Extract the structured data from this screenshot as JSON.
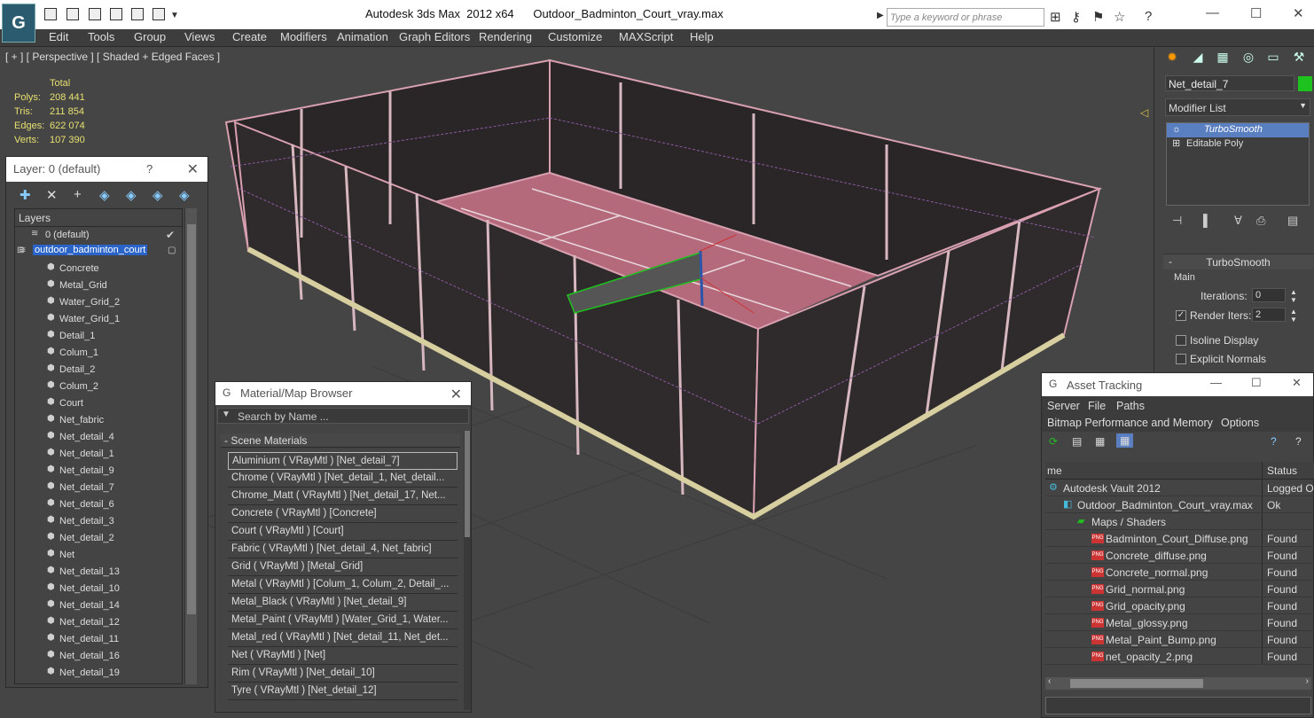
{
  "window": {
    "app_title": "Autodesk 3ds Max  2012 x64",
    "file_title": "Outdoor_Badminton_Court_vray.max"
  },
  "search": {
    "placeholder": "Type a keyword or phrase"
  },
  "menu": [
    "Edit",
    "Tools",
    "Group",
    "Views",
    "Create",
    "Modifiers",
    "Animation",
    "Graph Editors",
    "Rendering",
    "Customize",
    "MAXScript",
    "Help"
  ],
  "viewport": {
    "label": "[ + ] [ Perspective ] [ Shaded + Edged Faces ]",
    "stats": {
      "header": "Total",
      "polys_label": "Polys:",
      "polys": "208 441",
      "tris_label": "Tris:",
      "tris": "211 854",
      "edges_label": "Edges:",
      "edges": "622 074",
      "verts_label": "Verts:",
      "verts": "107 390"
    }
  },
  "layer_panel": {
    "title": "Layer: 0 (default)",
    "help": "?",
    "list_header": "Layers",
    "rows": [
      "0 (default)",
      "outdoor_badminton_court",
      "Concrete",
      "Metal_Grid",
      "Water_Grid_2",
      "Water_Grid_1",
      "Detail_1",
      "Colum_1",
      "Detail_2",
      "Colum_2",
      "Court",
      "Net_fabric",
      "Net_detail_4",
      "Net_detail_1",
      "Net_detail_9",
      "Net_detail_7",
      "Net_detail_6",
      "Net_detail_3",
      "Net_detail_2",
      "Net",
      "Net_detail_13",
      "Net_detail_10",
      "Net_detail_14",
      "Net_detail_12",
      "Net_detail_11",
      "Net_detail_16",
      "Net_detail_19"
    ]
  },
  "material_browser": {
    "title": "Material/Map Browser",
    "search_placeholder": "Search by Name ...",
    "group": "Scene Materials",
    "materials": [
      "Aluminium  ( VRayMtl )  [Net_detail_7]",
      "Chrome  ( VRayMtl )  [Net_detail_1, Net_detail...",
      "Chrome_Matt  ( VRayMtl )  [Net_detail_17, Net...",
      "Concrete  ( VRayMtl )  [Concrete]",
      "Court  ( VRayMtl )  [Court]",
      "Fabric  ( VRayMtl )  [Net_detail_4, Net_fabric]",
      "Grid  ( VRayMtl )  [Metal_Grid]",
      "Metal  ( VRayMtl )  [Colum_1, Colum_2, Detail_...",
      "Metal_Black  ( VRayMtl )  [Net_detail_9]",
      "Metal_Paint  ( VRayMtl )  [Water_Grid_1, Water...",
      "Metal_red  ( VRayMtl )  [Net_detail_11, Net_det...",
      "Net  ( VRayMtl )  [Net]",
      "Rim  ( VRayMtl )  [Net_detail_10]",
      "Tyre  ( VRayMtl )  [Net_detail_12]"
    ]
  },
  "command_panel": {
    "object_name": "Net_detail_7",
    "object_color": "#1ec21e",
    "modifier_list": "Modifier List",
    "stack": [
      "TurboSmooth",
      "Editable Poly"
    ],
    "rollout_title": "TurboSmooth",
    "main_label": "Main",
    "iterations_label": "Iterations:",
    "iterations": "0",
    "render_iters_label": "Render Iters:",
    "render_iters": "2",
    "render_iters_checked": true,
    "isoline_label": "Isoline Display",
    "explicit_label": "Explicit Normals"
  },
  "asset_tracking": {
    "title": "Asset Tracking",
    "menu": [
      "Server",
      "File",
      "Paths",
      "Bitmap Performance and Memory",
      "Options"
    ],
    "col_name": "me",
    "col_status": "Status",
    "rows": [
      {
        "name": "Autodesk Vault 2012",
        "status": "Logged O"
      },
      {
        "name": "Outdoor_Badminton_Court_vray.max",
        "status": "Ok"
      },
      {
        "name": "Maps / Shaders",
        "status": ""
      },
      {
        "name": "Badminton_Court_Diffuse.png",
        "status": "Found"
      },
      {
        "name": "Concrete_diffuse.png",
        "status": "Found"
      },
      {
        "name": "Concrete_normal.png",
        "status": "Found"
      },
      {
        "name": "Grid_normal.png",
        "status": "Found"
      },
      {
        "name": "Grid_opacity.png",
        "status": "Found"
      },
      {
        "name": "Metal_glossy.png",
        "status": "Found"
      },
      {
        "name": "Metal_Paint_Bump.png",
        "status": "Found"
      },
      {
        "name": "net_opacity_2.png",
        "status": "Found"
      }
    ]
  }
}
